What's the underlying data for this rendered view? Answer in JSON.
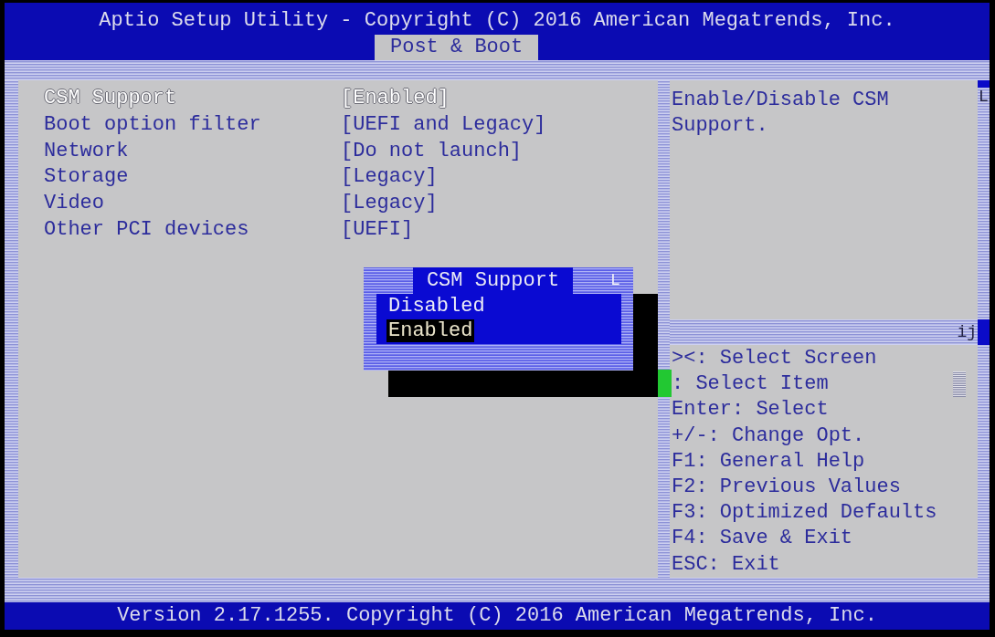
{
  "window": {
    "title": "Aptio Setup Utility - Copyright (C) 2016 American Megatrends, Inc."
  },
  "tabs": [
    {
      "label": "Post & Boot",
      "selected": true
    }
  ],
  "frame_marks": {
    "top_right": "L",
    "divider": "ij"
  },
  "settings": [
    {
      "label": "CSM Support",
      "value": "[Enabled]",
      "selected": true
    },
    {
      "label": "Boot option filter",
      "value": "[UEFI and Legacy]",
      "selected": false
    },
    {
      "label": "Network",
      "value": "[Do not launch]",
      "selected": false
    },
    {
      "label": "Storage",
      "value": "[Legacy]",
      "selected": false
    },
    {
      "label": "Video",
      "value": "[Legacy]",
      "selected": false
    },
    {
      "label": "Other PCI devices",
      "value": "[UEFI]",
      "selected": false
    }
  ],
  "help": {
    "text": "Enable/Disable CSM Support."
  },
  "key_help": [
    "><: Select Screen",
    ": Select Item",
    "Enter: Select",
    "+/-: Change Opt.",
    "F1: General Help",
    "F2: Previous Values",
    "F3: Optimized Defaults",
    "F4: Save & Exit",
    "ESC: Exit"
  ],
  "popup": {
    "title": "CSM Support",
    "mark": "L",
    "options": [
      {
        "label": "Disabled",
        "selected": false
      },
      {
        "label": "Enabled",
        "selected": true
      }
    ]
  },
  "status_bar": {
    "text": "Version 2.17.1255. Copyright (C) 2016 American Megatrends, Inc."
  }
}
